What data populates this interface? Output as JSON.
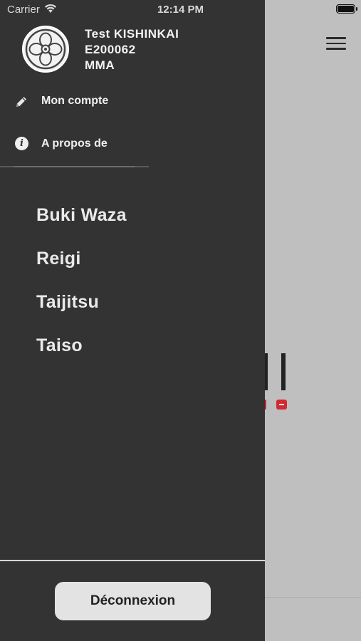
{
  "status_bar": {
    "carrier": "Carrier",
    "time": "12:14 PM"
  },
  "user": {
    "name": "Test KISHINKAI",
    "id": "E200062",
    "club": "MMA",
    "avatar_icon": "kamon-crest-icon"
  },
  "drawer_menu": {
    "account_label": "Mon compte",
    "account_icon": "pencil-icon",
    "about_label": "A propos de",
    "about_icon": "info-icon"
  },
  "categories": [
    "Buki Waza",
    "Reigi",
    "Taijitsu",
    "Taiso"
  ],
  "logout_label": "Déconnexion",
  "colors": {
    "drawer_bg": "#333333",
    "overlay_bg": "#bfbfbf",
    "accent_red": "#d12a31",
    "button_bg": "#e3e3e3"
  }
}
